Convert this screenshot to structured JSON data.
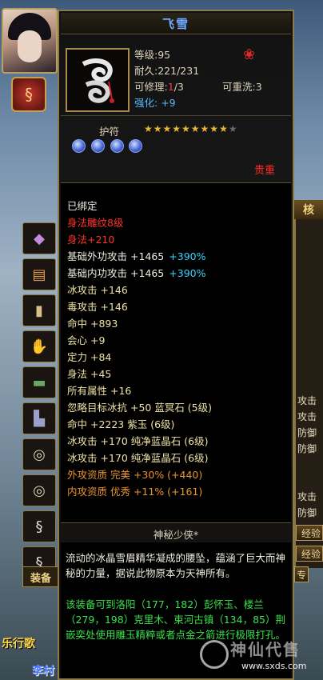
{
  "item": {
    "name": "飞雪",
    "level_label": "等级",
    "level": "95",
    "durability_label": "耐久",
    "durability": "221/231",
    "repairable_label": "可修理",
    "repairable_used": "1",
    "repairable_total": "/3",
    "rewash_label": "可重洗",
    "rewash": "3",
    "enhance_label": "强化",
    "enhance": "+9",
    "type": "护符",
    "stars_filled": "★★★★★★★★★",
    "stars_empty": "★",
    "star_count": 9,
    "star_max": 10,
    "gem_count": 4,
    "quality": "贵重"
  },
  "stats": [
    {
      "text": "已绑定",
      "color": "white"
    },
    {
      "text": "身法雕纹8级",
      "color": "red"
    },
    {
      "text": "身法+210",
      "color": "red"
    },
    {
      "text": "基础外功攻击 +1465",
      "extra": "+390%",
      "color": "white"
    },
    {
      "text": "基础内功攻击 +1465",
      "extra": "+390%",
      "color": "white"
    },
    {
      "text": "冰攻击 +146",
      "color": "yellow"
    },
    {
      "text": "毒攻击 +146",
      "color": "yellow"
    },
    {
      "text": "命中 +893",
      "color": "yellow"
    },
    {
      "text": "会心 +9",
      "color": "yellow"
    },
    {
      "text": "定力 +84",
      "color": "yellow"
    },
    {
      "text": "身法 +45",
      "color": "yellow"
    },
    {
      "text": "所有属性 +16",
      "color": "yellow"
    },
    {
      "text": "忽略目标冰抗 +50 蓝冥石 (5级)",
      "color": "yellow"
    },
    {
      "text": "命中 +2223 紫玉 (6级)",
      "color": "yellow"
    },
    {
      "text": "冰攻击 +170 纯净蓝晶石 (6级)",
      "color": "yellow"
    },
    {
      "text": "冰攻击 +170 纯净蓝晶石 (6级)",
      "color": "yellow"
    },
    {
      "text": "外攻资质   完美 +30% (+440)",
      "color": "orange"
    },
    {
      "text": "内攻资质   优秀 +11% (+161)",
      "color": "orange"
    }
  ],
  "section_title": "神秘少侠*",
  "description": "流动的冰晶雪眉精华凝成的腰坠，蕴涵了巨大而神秘的力量，据说此物原本为天神所有。",
  "source": "该装备可到洛阳（177，182）彭怀玉、楼兰（279，198）克里木、束河古镇（134，85）荆嵌奕处使用雕玉精粹或者点金之箭进行极限打孔。",
  "left_panel": {
    "equip_tab": "装备",
    "bottom_text_1": "乐行歌",
    "bottom_text_2": "李村"
  },
  "right_panel": {
    "tab_label": "核",
    "labels": [
      "攻击",
      "攻击",
      "防御",
      "防御",
      "攻击",
      "防御"
    ],
    "buttons": [
      "经验",
      "经验",
      "专"
    ]
  },
  "watermark": {
    "text": "神仙代售",
    "url": "www.sxds.com"
  }
}
